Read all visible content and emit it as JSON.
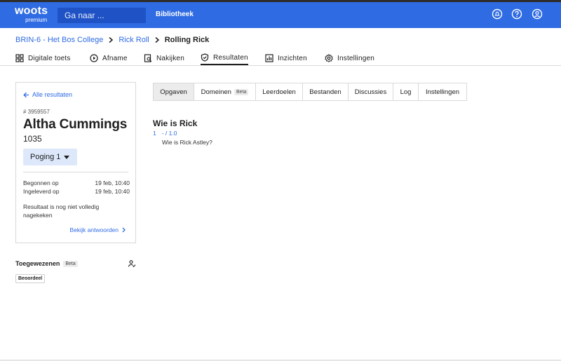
{
  "topbar": {
    "logo_line1": "woots",
    "logo_line2": "premium",
    "search_placeholder": "Ga naar ...",
    "library_label": "Bibliotheek",
    "brand_color": "#2f6be3",
    "icons": [
      "notifications-icon",
      "help-icon",
      "user-icon"
    ]
  },
  "breadcrumb": {
    "items": [
      "BRIN-6 - Het Bos College",
      "Rick Roll"
    ],
    "current": "Rolling Rick"
  },
  "mainnav": {
    "items": [
      {
        "label": "Digitale toets",
        "icon": "grid-icon"
      },
      {
        "label": "Afname",
        "icon": "play-icon"
      },
      {
        "label": "Nakijken",
        "icon": "review-icon"
      },
      {
        "label": "Resultaten",
        "icon": "shield-check-icon",
        "active": true
      },
      {
        "label": "Inzichten",
        "icon": "chart-icon"
      },
      {
        "label": "Instellingen",
        "icon": "gear-icon"
      }
    ]
  },
  "student": {
    "back_label": "Alle resultaten",
    "id": "# 3959557",
    "name": "Altha Cummings",
    "code": "1035",
    "attempt_label": "Poging 1",
    "started_label": "Begonnen op",
    "started_value": "19 feb, 10:40",
    "submitted_label": "Ingeleverd op",
    "submitted_value": "19 feb, 10:40",
    "status": "Resultaat is nog niet volledig nagekeken",
    "view_answers": "Bekijk antwoorden"
  },
  "assigned": {
    "label": "Toegewezenen",
    "beta": "Beta",
    "tag": "Beoordeel"
  },
  "tabs": [
    {
      "label": "Opgaven",
      "active": true
    },
    {
      "label": "Domeinen",
      "badge": "Beta"
    },
    {
      "label": "Leerdoelen"
    },
    {
      "label": "Bestanden"
    },
    {
      "label": "Discussies"
    },
    {
      "label": "Log"
    },
    {
      "label": "Instellingen"
    }
  ],
  "question": {
    "title": "Wie is Rick",
    "number": "1",
    "score": "- / 1.0",
    "text": "Wie is Rick Astley?"
  }
}
